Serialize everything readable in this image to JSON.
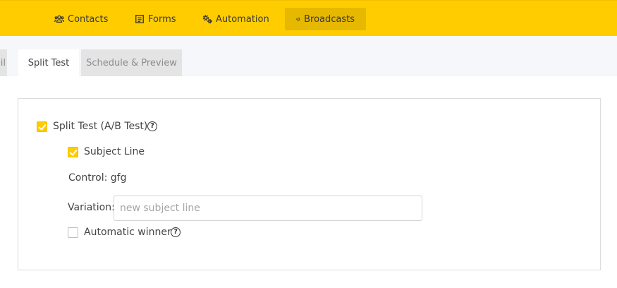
{
  "nav": {
    "items": [
      {
        "label": "Contacts",
        "icon": "users-icon"
      },
      {
        "label": "Forms",
        "icon": "form-icon"
      },
      {
        "label": "Automation",
        "icon": "gears-icon"
      },
      {
        "label": "Broadcasts",
        "icon": "megaphone-icon",
        "active": true
      }
    ]
  },
  "tabs": {
    "cut_label": "il",
    "split_test": "Split Test",
    "schedule": "Schedule & Preview"
  },
  "split_test": {
    "enabled_label": "Split Test (A/B Test)",
    "enabled": true,
    "subject_line_label": "Subject Line",
    "subject_line_checked": true,
    "control_text": "Control: gfg",
    "variation_label": "Variation:",
    "variation_value": "",
    "variation_placeholder": "new subject line",
    "automatic_winner_label": "Automatic winner",
    "automatic_winner_checked": false,
    "help_glyph": "?"
  },
  "colors": {
    "accent": "#ffcc00",
    "accent_active": "#e6b800"
  }
}
